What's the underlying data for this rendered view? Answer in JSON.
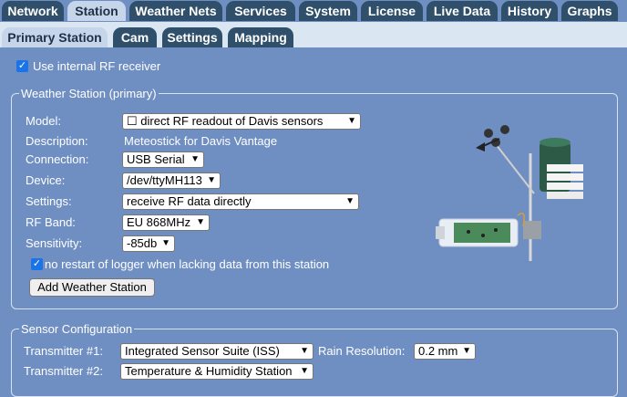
{
  "main_tabs": [
    "Network",
    "Station",
    "Weather Nets",
    "Services",
    "System",
    "License",
    "Live Data",
    "History",
    "Graphs"
  ],
  "sub_tabs": [
    "Primary Station",
    "Cam",
    "Settings",
    "Mapping"
  ],
  "use_internal_rf": {
    "label": "Use internal RF receiver",
    "checked": true
  },
  "station": {
    "legend": "Weather Station (primary)",
    "labels": {
      "model": "Model:",
      "description": "Description:",
      "connection": "Connection:",
      "device": "Device:",
      "settings": "Settings:",
      "rf_band": "RF Band:",
      "sensitivity": "Sensitivity:"
    },
    "model_value": "☐ direct RF readout of Davis sensors",
    "description_value": "Meteostick for Davis Vantage",
    "connection_value": "USB Serial",
    "device_value": "/dev/ttyMH113",
    "settings_value": "receive RF data directly",
    "rf_band_value": "EU 868MHz",
    "sensitivity_value": "-85db",
    "no_restart_label": "no restart of logger when lacking data from this station",
    "add_button": "Add Weather Station"
  },
  "sensor_config": {
    "legend": "Sensor Configuration",
    "transmitter1_label": "Transmitter #1:",
    "transmitter1_value": "Integrated Sensor Suite (ISS)",
    "rain_resolution_label": "Rain Resolution:",
    "rain_resolution_value": "0.2 mm",
    "transmitter2_label": "Transmitter #2:",
    "transmitter2_value": "Temperature & Humidity Station"
  },
  "colors": {
    "background": "#6f8fc3",
    "tab_dark": "#2f4f6a",
    "tab_active": "#c6d5ea",
    "subbar": "#dbe6f3"
  }
}
